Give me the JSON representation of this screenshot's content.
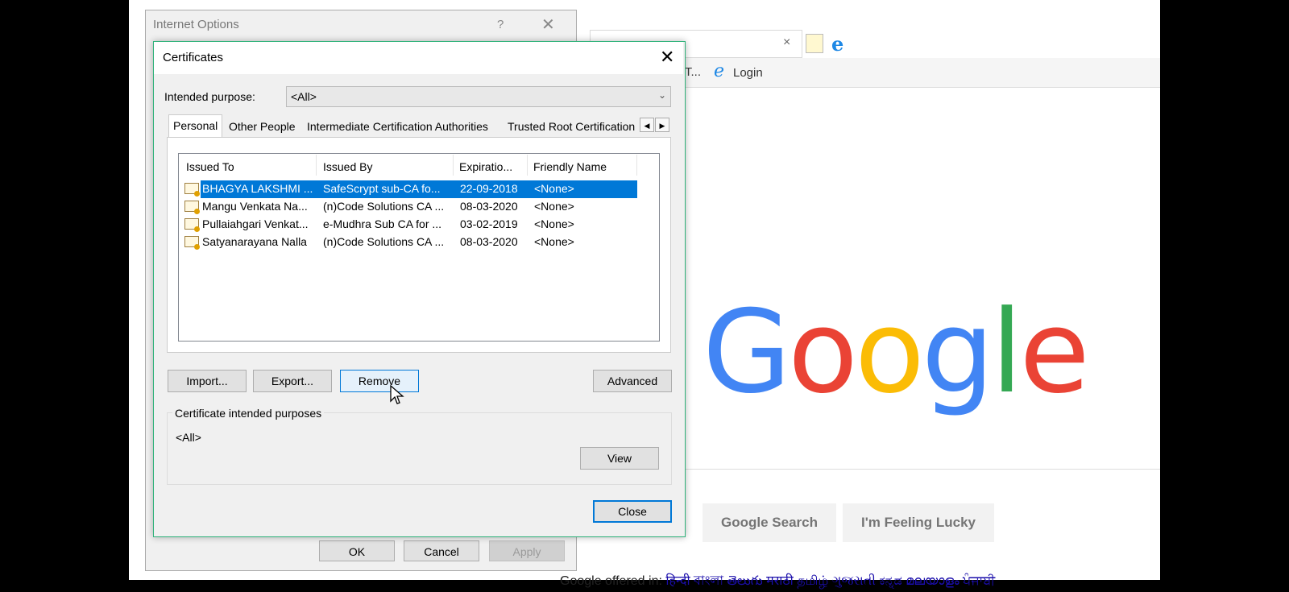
{
  "browser": {
    "tab_close": "×",
    "favorites_truncated": "T...",
    "favorite_login": "Login",
    "google_logo": [
      "G",
      "o",
      "o",
      "g",
      "l",
      "e"
    ],
    "google_colors": [
      "#4285F4",
      "#EA4335",
      "#FBBC05",
      "#4285F4",
      "#34A853",
      "#EA4335"
    ],
    "google_search_btn": "Google Search",
    "feeling_lucky_btn": "I'm Feeling Lucky",
    "offered_in": "Google offered in:",
    "offered_languages": "हिन्दी  বাংলা  తెలుగు  मराठी  தமிழ்  ગુજરાતી  ಕನ್ನಡ  മലയാളം  ਪੰਜਾਬੀ"
  },
  "internet_options": {
    "title": "Internet Options",
    "help": "?",
    "close": "✕",
    "ok": "OK",
    "cancel": "Cancel",
    "apply": "Apply"
  },
  "certificates": {
    "title": "Certificates",
    "close_x": "✕",
    "intended_purpose_label": "Intended purpose:",
    "intended_purpose_value": "<All>",
    "tabs": [
      {
        "label": "Personal",
        "active": true
      },
      {
        "label": "Other People"
      },
      {
        "label": "Intermediate Certification Authorities"
      },
      {
        "label": "Trusted Root Certification"
      }
    ],
    "tab_scroll_left": "◀",
    "tab_scroll_right": "▶",
    "columns": [
      "Issued To",
      "Issued By",
      "Expiratio...",
      "Friendly Name"
    ],
    "rows": [
      {
        "issued_to": "BHAGYA LAKSHMI ...",
        "issued_by": "SafeScrypt sub-CA fo...",
        "expiration": "22-09-2018",
        "friendly_name": "<None>",
        "selected": true
      },
      {
        "issued_to": "Mangu Venkata Na...",
        "issued_by": "(n)Code Solutions CA ...",
        "expiration": "08-03-2020",
        "friendly_name": "<None>"
      },
      {
        "issued_to": "Pullaiahgari Venkat...",
        "issued_by": "e-Mudhra Sub CA for ...",
        "expiration": "03-02-2019",
        "friendly_name": "<None>"
      },
      {
        "issued_to": "Satyanarayana Nalla",
        "issued_by": "(n)Code Solutions CA ...",
        "expiration": "08-03-2020",
        "friendly_name": "<None>"
      }
    ],
    "buttons": {
      "import": "Import...",
      "export": "Export...",
      "remove": "Remove",
      "advanced": "Advanced",
      "view": "View",
      "close": "Close"
    },
    "intended_purposes_group": "Certificate intended purposes",
    "intended_purposes_value": "<All>"
  },
  "colors": {
    "accent": "#0078d7",
    "dialog_border": "#2fb27a"
  }
}
